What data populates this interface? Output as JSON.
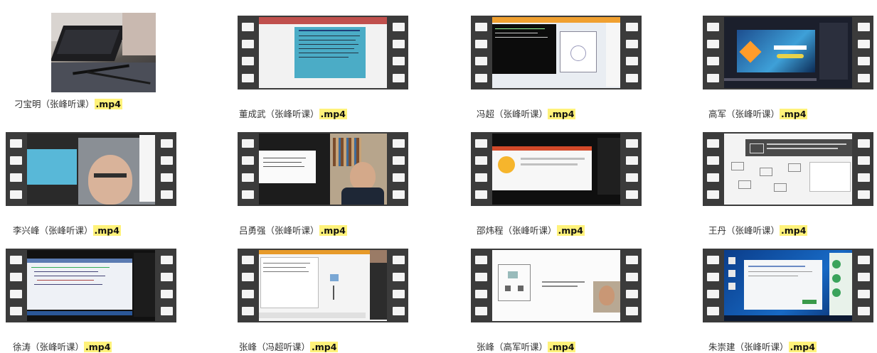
{
  "videos": [
    {
      "name": "刁宝明（张峰听课）",
      "ext": ".mp4",
      "kind": "photo"
    },
    {
      "name": "董成武（张峰听课）",
      "ext": ".mp4",
      "kind": "document"
    },
    {
      "name": "冯超（张峰听课）",
      "ext": ".mp4",
      "kind": "terminal"
    },
    {
      "name": "高军（张峰听课）",
      "ext": ".mp4",
      "kind": "slides"
    },
    {
      "name": "李兴峰（张峰听课）",
      "ext": ".mp4",
      "kind": "webcam"
    },
    {
      "name": "吕勇强（张峰听课）",
      "ext": ".mp4",
      "kind": "webcam-room"
    },
    {
      "name": "邵炜程（张峰听课）",
      "ext": ".mp4",
      "kind": "dark-app"
    },
    {
      "name": "王丹（张峰听课）",
      "ext": ".mp4",
      "kind": "network"
    },
    {
      "name": "徐涛（张峰听课）",
      "ext": ".mp4",
      "kind": "code"
    },
    {
      "name": "张峰（冯超听课）",
      "ext": ".mp4",
      "kind": "packet-tracer"
    },
    {
      "name": "张峰（高军听课）",
      "ext": ".mp4",
      "kind": "diagram-webcam"
    },
    {
      "name": "朱崇建（张峰听课）",
      "ext": ".mp4",
      "kind": "desktop-chat"
    }
  ]
}
